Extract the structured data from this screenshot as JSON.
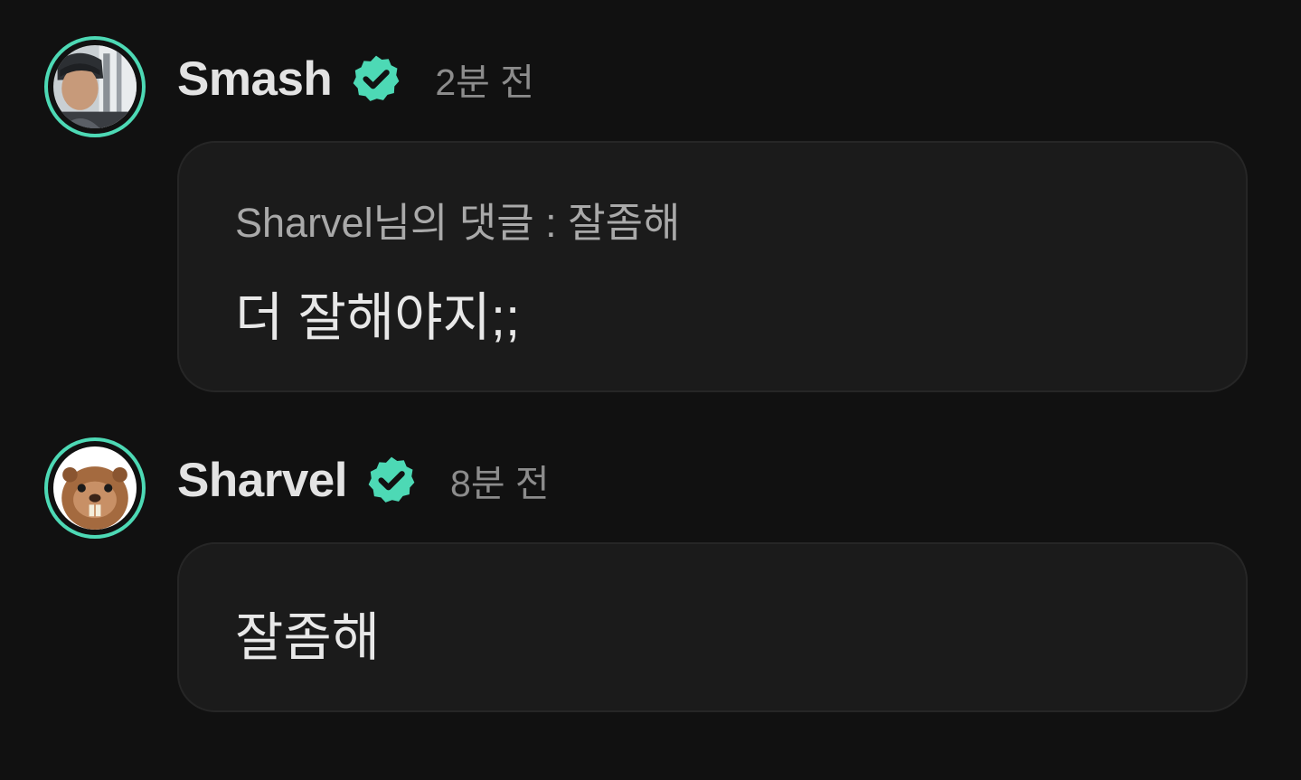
{
  "colors": {
    "background": "#111111",
    "bubble": "#1b1b1b",
    "accent": "#4dd9b5",
    "username": "#e3e3e3",
    "timestamp": "#8c8c8c"
  },
  "comments": [
    {
      "username": "Smash",
      "verified": true,
      "verified_icon": "verified-check-icon",
      "timestamp": "2분 전",
      "avatar_icon": "user-photo-avatar",
      "reply_to": "Sharvel님의 댓글 : 잘좀해",
      "text": "더 잘해야지;;"
    },
    {
      "username": "Sharvel",
      "verified": true,
      "verified_icon": "verified-check-icon",
      "timestamp": "8분 전",
      "avatar_icon": "beaver-avatar",
      "text": "잘좀해"
    }
  ]
}
